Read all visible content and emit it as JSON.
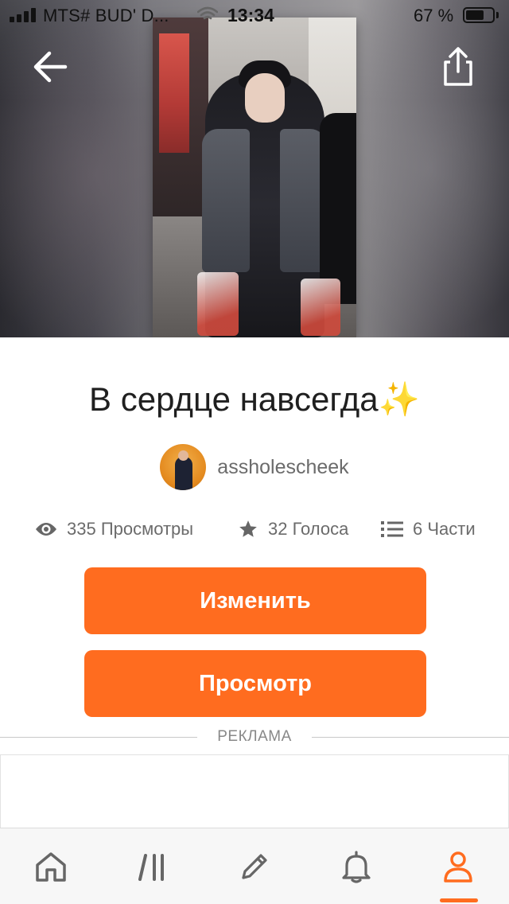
{
  "status_bar": {
    "carrier": "MTS# BUD' D...",
    "time": "13:34",
    "battery_percent": "67 %",
    "battery_level": 0.67,
    "icons": [
      "signal-icon",
      "wifi-icon",
      "battery-icon"
    ]
  },
  "header": {
    "back_icon": "arrow-left-icon",
    "share_icon": "share-icon",
    "cover_image": "story-cover-image"
  },
  "story": {
    "title": "В сердце навсегда✨",
    "author": {
      "name": "assholescheek",
      "avatar": "author-avatar"
    },
    "stats": {
      "views": "335 Просмотры",
      "votes": "32 Голоса",
      "parts": "6 Части"
    }
  },
  "actions": {
    "edit_label": "Изменить",
    "preview_label": "Просмотр"
  },
  "ad": {
    "label": "РЕКЛАМА"
  },
  "tabbar": {
    "items": [
      {
        "icon": "home-icon",
        "active": false
      },
      {
        "icon": "library-icon",
        "active": false
      },
      {
        "icon": "pencil-icon",
        "active": false
      },
      {
        "icon": "bell-icon",
        "active": false
      },
      {
        "icon": "profile-icon",
        "active": true
      }
    ]
  },
  "colors": {
    "accent": "#ff6c1f",
    "text_primary": "#1f1f1f",
    "text_secondary": "#6b6b6b",
    "icon_gray": "#666666"
  }
}
